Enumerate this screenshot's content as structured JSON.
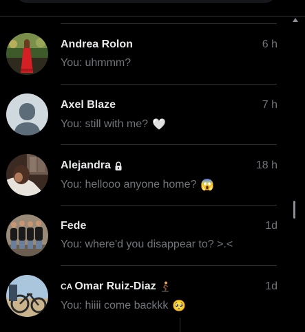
{
  "conversations": [
    {
      "name": "Andrea Rolon",
      "prefix": "",
      "suffix_icon": "",
      "time": "6 h",
      "you_label": "You:",
      "message": "uhmmm?",
      "emoji": "",
      "avatar": "photo-red-dress"
    },
    {
      "name": "Axel Blaze",
      "prefix": "",
      "suffix_icon": "",
      "time": "7 h",
      "you_label": "You:",
      "message": "still with me?",
      "emoji": "🤍",
      "avatar": "default-avatar"
    },
    {
      "name": "Alejandra",
      "prefix": "",
      "suffix_icon": "lock-icon",
      "time": "18 h",
      "you_label": "You:",
      "message": "hellooo anyone home?",
      "emoji": "😱",
      "avatar": "photo-dark"
    },
    {
      "name": "Fede",
      "prefix": "",
      "suffix_icon": "",
      "time": "1d",
      "you_label": "You:",
      "message": "where'd you disappear to? >.<",
      "emoji": "",
      "avatar": "photo-group"
    },
    {
      "name": "Omar Ruiz-Diaz",
      "prefix": "CA",
      "suffix_icon": "skateboarder-emoji",
      "time": "1d",
      "you_label": "You:",
      "message": "hiiii come backkk",
      "emoji": "🥺",
      "avatar": "photo-bike"
    }
  ],
  "colors": {
    "background": "#000000",
    "primary_text": "#e7e9ea",
    "secondary_text": "#71767b",
    "divider": "#2f3336"
  }
}
